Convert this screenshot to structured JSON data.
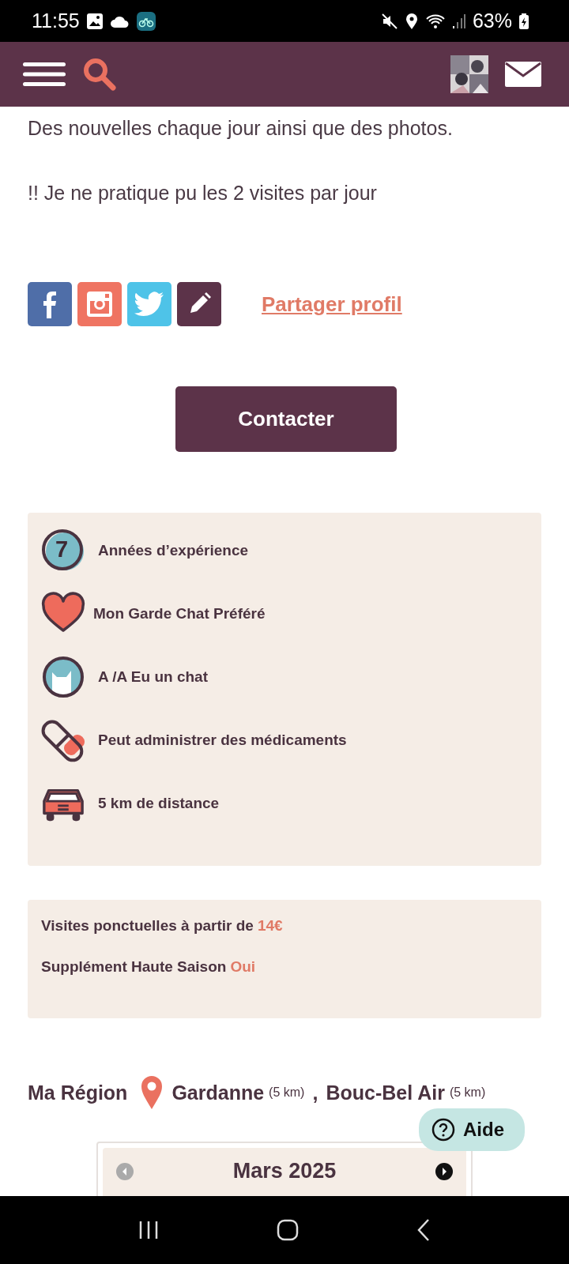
{
  "status_bar": {
    "time": "11:55",
    "battery": "63%"
  },
  "description": [
    "Des nouvelles chaque jour ainsi que des photos.",
    "!! Je ne pratique pu les 2 visites par jour"
  ],
  "share": {
    "buttons": [
      {
        "kind": "facebook"
      },
      {
        "kind": "instagram"
      },
      {
        "kind": "twitter"
      },
      {
        "kind": "edit"
      }
    ],
    "link": "Partager profil"
  },
  "contact_button": "Contacter",
  "features": [
    {
      "kind": "years",
      "badge": "7",
      "label": "Années d’expérience"
    },
    {
      "kind": "favorite",
      "label": "Mon Garde Chat Préféré"
    },
    {
      "kind": "cat",
      "label": "A /A Eu un chat"
    },
    {
      "kind": "medication",
      "label": "Peut administrer des médicaments"
    },
    {
      "kind": "car",
      "label": "5 km de distance"
    }
  ],
  "pricing": [
    {
      "label": "Visites ponctuelles à partir de",
      "value": "14€"
    },
    {
      "label": "Supplément Haute Saison",
      "value": "Oui"
    }
  ],
  "region": {
    "label": "Ma Région",
    "places": [
      {
        "name": "Gardanne",
        "distance": "(5 km)"
      },
      {
        "prefix": ",",
        "name": "Bouc-Bel Air",
        "distance": "(5 km)"
      }
    ]
  },
  "help_button": "Aide",
  "calendar": {
    "month": "Mars 2025",
    "nav": [
      {
        "kind": "prev",
        "disabled": true
      },
      {
        "kind": "next",
        "disabled": false
      }
    ]
  }
}
